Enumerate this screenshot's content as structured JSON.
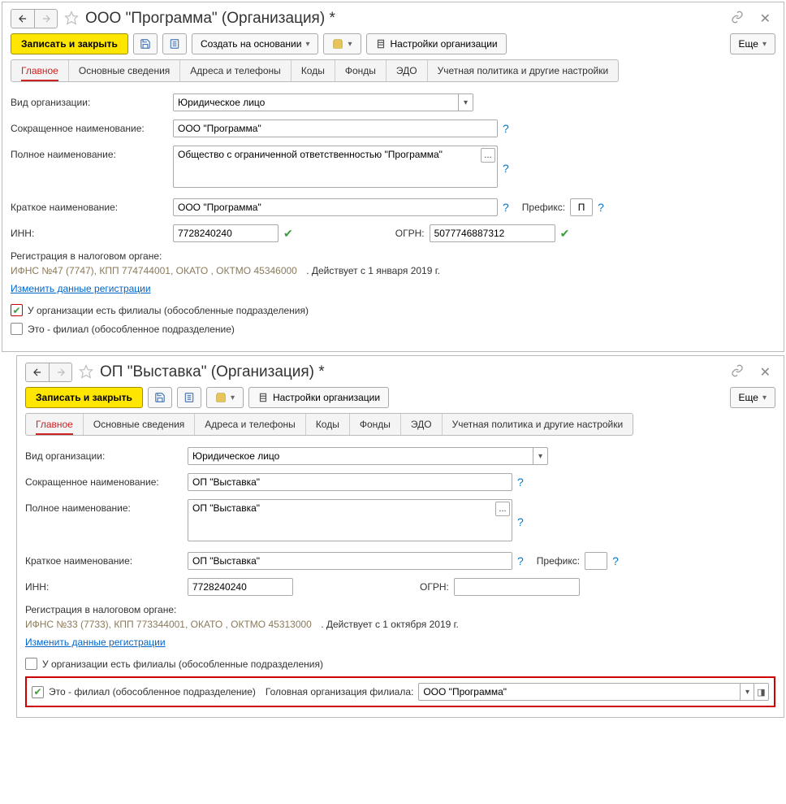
{
  "window1": {
    "title": "ООО \"Программа\" (Организация) *",
    "toolbar": {
      "save_close": "Записать и закрыть",
      "create_based": "Создать на основании",
      "org_settings": "Настройки организации",
      "more": "Еще"
    },
    "tabs": [
      "Главное",
      "Основные сведения",
      "Адреса и телефоны",
      "Коды",
      "Фонды",
      "ЭДО",
      "Учетная политика и другие настройки"
    ],
    "fields": {
      "org_type_label": "Вид организации:",
      "org_type_value": "Юридическое лицо",
      "short_name_label": "Сокращенное наименование:",
      "short_name_value": "ООО \"Программа\"",
      "full_name_label": "Полное наименование:",
      "full_name_value": "Общество с ограниченной ответственностью \"Программа\"",
      "brief_name_label": "Краткое наименование:",
      "brief_name_value": "ООО \"Программа\"",
      "prefix_label": "Префикс:",
      "prefix_value": "П",
      "inn_label": "ИНН:",
      "inn_value": "7728240240",
      "ogrn_label": "ОГРН:",
      "ogrn_value": "5077746887312",
      "tax_reg_label": "Регистрация в налоговом органе:",
      "tax_reg_info": "ИФНС №47 (7747), КПП 774744001, ОКАТО , ОКТМО 45346000",
      "tax_reg_date": ". Действует с 1 января 2019 г.",
      "change_reg_link": "Изменить данные регистрации",
      "has_branches": "У организации есть филиалы (обособленные подразделения)",
      "is_branch": "Это - филиал (обособленное подразделение)"
    }
  },
  "window2": {
    "title": "ОП \"Выставка\" (Организация) *",
    "toolbar": {
      "save_close": "Записать и закрыть",
      "org_settings": "Настройки организации",
      "more": "Еще"
    },
    "tabs": [
      "Главное",
      "Основные сведения",
      "Адреса и телефоны",
      "Коды",
      "Фонды",
      "ЭДО",
      "Учетная политика и другие настройки"
    ],
    "fields": {
      "org_type_label": "Вид организации:",
      "org_type_value": "Юридическое лицо",
      "short_name_label": "Сокращенное наименование:",
      "short_name_value": "ОП \"Выставка\"",
      "full_name_label": "Полное наименование:",
      "full_name_value": "ОП \"Выставка\"",
      "brief_name_label": "Краткое наименование:",
      "brief_name_value": "ОП \"Выставка\"",
      "prefix_label": "Префикс:",
      "prefix_value": "",
      "inn_label": "ИНН:",
      "inn_value": "7728240240",
      "ogrn_label": "ОГРН:",
      "ogrn_value": "",
      "tax_reg_label": "Регистрация в налоговом органе:",
      "tax_reg_info": "ИФНС №33 (7733), КПП 773344001, ОКАТО , ОКТМО 45313000",
      "tax_reg_date": ". Действует с 1 октября 2019 г.",
      "change_reg_link": "Изменить данные регистрации",
      "has_branches": "У организации есть филиалы (обособленные подразделения)",
      "is_branch": "Это - филиал (обособленное подразделение)",
      "parent_org_label": "Головная организация филиала:",
      "parent_org_value": "ООО \"Программа\""
    }
  }
}
